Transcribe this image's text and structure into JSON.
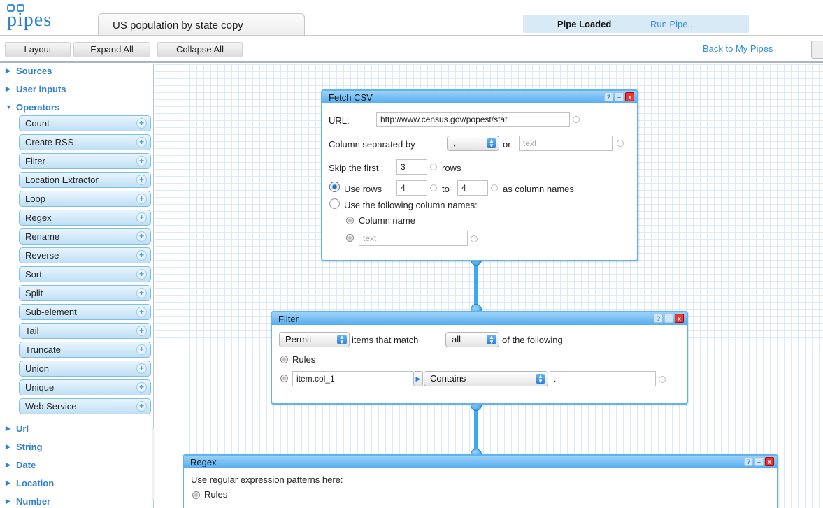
{
  "header": {
    "logo_text": "pipes",
    "pipe_name": "US population by state copy",
    "status": "Pipe Loaded",
    "run_link": "Run Pipe..."
  },
  "toolbar": {
    "layout": "Layout",
    "expand_all": "Expand All",
    "collapse_all": "Collapse All",
    "back_link": "Back to My Pipes"
  },
  "sidebar": {
    "sources": "Sources",
    "user_inputs": "User inputs",
    "operators": "Operators",
    "operator_items": [
      "Count",
      "Create RSS",
      "Filter",
      "Location Extractor",
      "Loop",
      "Regex",
      "Rename",
      "Reverse",
      "Sort",
      "Split",
      "Sub-element",
      "Tail",
      "Truncate",
      "Union",
      "Unique",
      "Web Service"
    ],
    "url": "Url",
    "string": "String",
    "date": "Date",
    "location": "Location",
    "number": "Number"
  },
  "fetch_csv": {
    "title": "Fetch CSV",
    "url_label": "URL:",
    "url_value": "http://www.census.gov/popest/stat",
    "sep_label": "Column separated by",
    "sep_value": ",",
    "or": "or",
    "sep_placeholder": "text",
    "skip_label": "Skip the first",
    "skip_value": "3",
    "rows": "rows",
    "use_rows": "Use rows",
    "row_from": "4",
    "to": "to",
    "row_to": "4",
    "as_col_names": "as column names",
    "use_following": "Use the following column names:",
    "column_name": "Column name",
    "col_placeholder": "text"
  },
  "filter": {
    "title": "Filter",
    "mode": "Permit",
    "items_that_match": "items that match",
    "match_value": "all",
    "of_following": "of the following",
    "rules": "Rules",
    "rule_field": "item.col_1",
    "rule_op": "Contains",
    "rule_value": "."
  },
  "regex": {
    "title": "Regex",
    "description": "Use regular expression patterns here:",
    "rules": "Rules"
  },
  "module_controls": {
    "help": "?",
    "min": "–",
    "close": "x"
  }
}
